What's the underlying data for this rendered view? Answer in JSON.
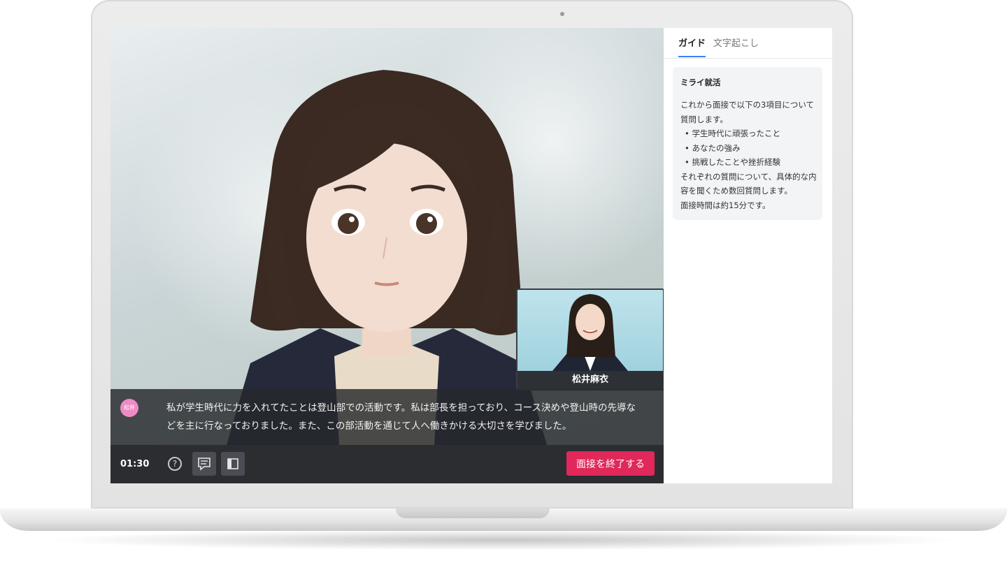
{
  "interview": {
    "timer": "01:30",
    "end_button": "面接を終了する",
    "help_icon": "question-circle-icon",
    "chat_icon": "chat-bubble-icon",
    "panel_icon": "side-panel-icon"
  },
  "pip": {
    "name": "松井麻衣"
  },
  "caption": {
    "speaker_label": "松井",
    "text": "私が学生時代に力を入れてたことは登山部での活動です。私は部長を担っており、コース決めや登山時の先導などを主に行なっておりました。また、この部活動を通じて人へ働きかける大切さを学びました。"
  },
  "panel": {
    "tabs": [
      {
        "label": "ガイド",
        "active": true
      },
      {
        "label": "文字起こし",
        "active": false
      }
    ],
    "guide": {
      "title": "ミライ就活",
      "intro": "これから面接で以下の3項目について質問します。",
      "items": [
        "学生時代に頑張ったこと",
        "あなたの強み",
        "挑戦したことや挫折経験"
      ],
      "outro": "それぞれの質問について、具体的な内容を聞くため数回質問します。",
      "duration": "面接時間は約15分です。"
    }
  },
  "colors": {
    "end_button": "#e0285a",
    "tab_accent": "#3b82f6",
    "speaker_dot": "#f08ac6"
  }
}
